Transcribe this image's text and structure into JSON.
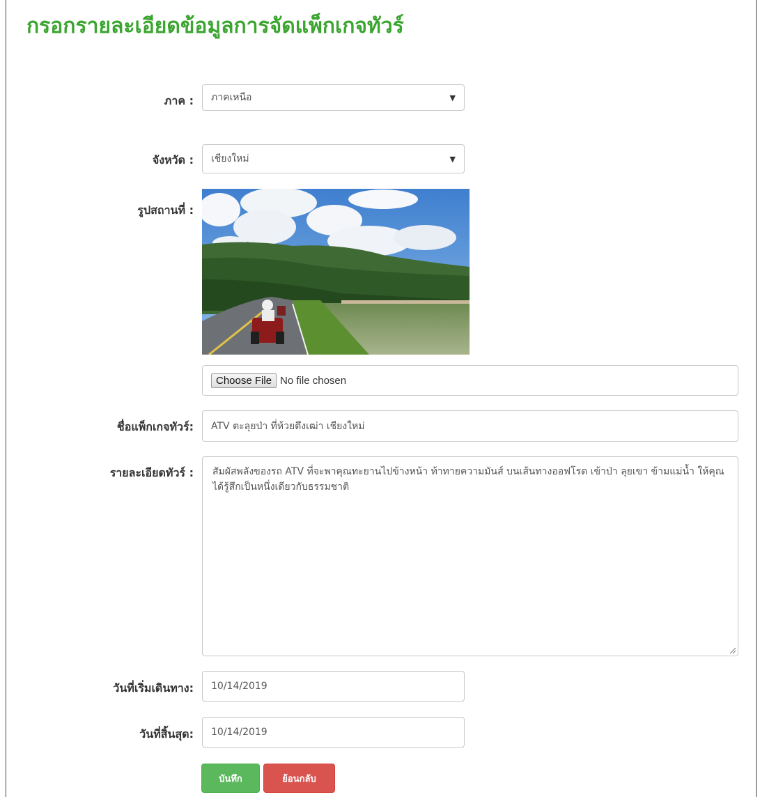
{
  "page": {
    "title": "กรอกรายละเอียดข้อมูลการจัดแพ็กเกจทัวร์"
  },
  "form": {
    "region": {
      "label": "ภาค :",
      "value": "ภาคเหนือ"
    },
    "province": {
      "label": "จังหวัด :",
      "value": "เชียงใหม่"
    },
    "photo": {
      "label": "รูปสถานที่ :",
      "choose_file_label": "Choose File",
      "file_status": "No file chosen"
    },
    "package_name": {
      "label": "ชื่อแพ็กเกจทัวร์:",
      "value": "ATV ตะลุยป่า ที่ห้วยตึงเฒ่า เชียงใหม่"
    },
    "details": {
      "label": "รายละเอียดทัวร์ :",
      "value": "สัมผัสพลังของรถ ATV ที่จะพาคุณทะยานไปข้างหน้า ท้าทายความมันส์ บนเส้นทางออฟโรด เข้าป่า ลุยเขา ข้ามแม่น้ำ ให้คุณได้รู้สึกเป็นหนึ่งเดียวกับธรรมชาติ"
    },
    "start_date": {
      "label": "วันที่เริ่มเดินทาง:",
      "value": "10/14/2019"
    },
    "end_date": {
      "label": "วันที่สิ้นสุด:",
      "value": "10/14/2019"
    },
    "actions": {
      "save_label": "บันทึก",
      "back_label": "ย้อนกลับ"
    }
  },
  "icons": {
    "select_arrow": "caret-down-icon",
    "resize": "resize-grip-icon"
  },
  "colors": {
    "title": "#3aa52f",
    "save": "#5cb85c",
    "back": "#d9534f"
  }
}
